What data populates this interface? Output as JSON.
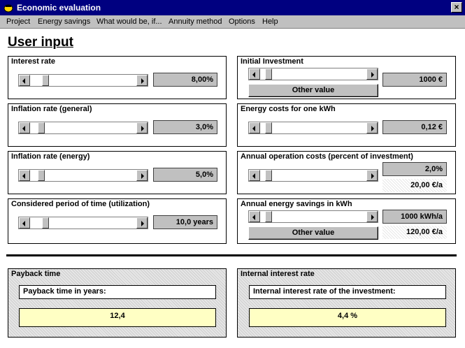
{
  "window": {
    "title": "Economic evaluation",
    "close_glyph": "×"
  },
  "menu": [
    "Project",
    "Energy savings",
    "What would be, if...",
    "Annuity method",
    "Options",
    "Help"
  ],
  "heading": "User input",
  "inputs": {
    "interest_rate": {
      "label": "Interest rate",
      "value": "8,00%",
      "level": 0.12
    },
    "inflation_general": {
      "label": "Inflation rate (general)",
      "value": "3,0%",
      "level": 0.08
    },
    "inflation_energy": {
      "label": "Inflation rate (energy)",
      "value": "5,0%",
      "level": 0.08
    },
    "period": {
      "label": "Considered period of time (utilization)",
      "value": "10,0 years",
      "level": 0.12
    },
    "initial_investment": {
      "label": "Initial Investment",
      "value": "1000 €",
      "button": "Other value",
      "level": 0.05
    },
    "energy_costs": {
      "label": "Energy costs for one kWh",
      "value": "0,12 €",
      "level": 0.05
    },
    "operation_costs": {
      "label": "Annual operation costs (percent of investment)",
      "value": "2,0%",
      "derived": "20,00 €/a",
      "level": 0.05
    },
    "energy_savings": {
      "label": "Annual energy savings in kWh",
      "value": "1000 kWh/a",
      "derived": "120,00 €/a",
      "button": "Other value",
      "level": 0.05
    }
  },
  "results": {
    "payback": {
      "panel_title": "Payback time",
      "caption": "Payback time in years:",
      "value": "12,4"
    },
    "irr": {
      "panel_title": "Internal interest rate",
      "caption": "Internal interest rate of the investment:",
      "value": "4,4 %"
    }
  }
}
